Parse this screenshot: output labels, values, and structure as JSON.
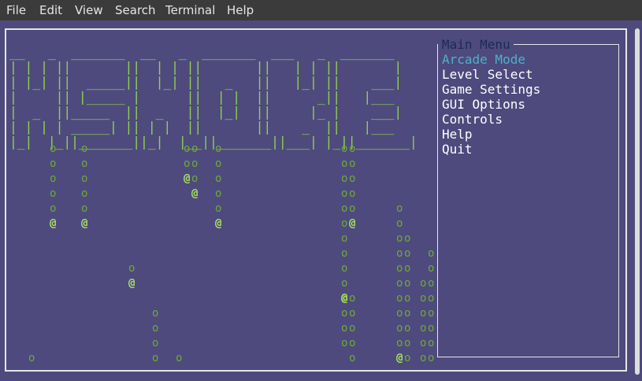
{
  "menubar": {
    "items": [
      "File",
      "Edit",
      "View",
      "Search",
      "Terminal",
      "Help"
    ]
  },
  "logo_art": [
    "__   _  _______  __   _  _______  ___   _  _______",
    "| | | ||       ||  | | ||       ||   | | ||       |",
    "| |_| ||  _____||  |_| ||   _   ||   |_| ||    ___|",
    "|     || |_____ |      ||  | |  ||      _||   |___ ",
    "|  _  ||_____  ||  _   ||  |_|  ||     |_ |    ___|",
    "| | | | _____| || | |  ||       ||    _  ||   |___ ",
    "|_|  |_||_______||_|  |__||_______||___| |_||_______|"
  ],
  "main_menu": {
    "title": "Main Menu",
    "options": [
      "Arcade Mode",
      "Level Select",
      "Game Settings",
      "GUI Options",
      "Controls",
      "Help",
      "Quit"
    ],
    "selected_index": 0
  },
  "rain_glyphs": {
    "trail": "o",
    "head": "@"
  },
  "colors": {
    "background": "#4e4a7d",
    "logo": "#8fd14f",
    "highlight": "#4db0c8",
    "menu_title": "#1d2a55"
  }
}
